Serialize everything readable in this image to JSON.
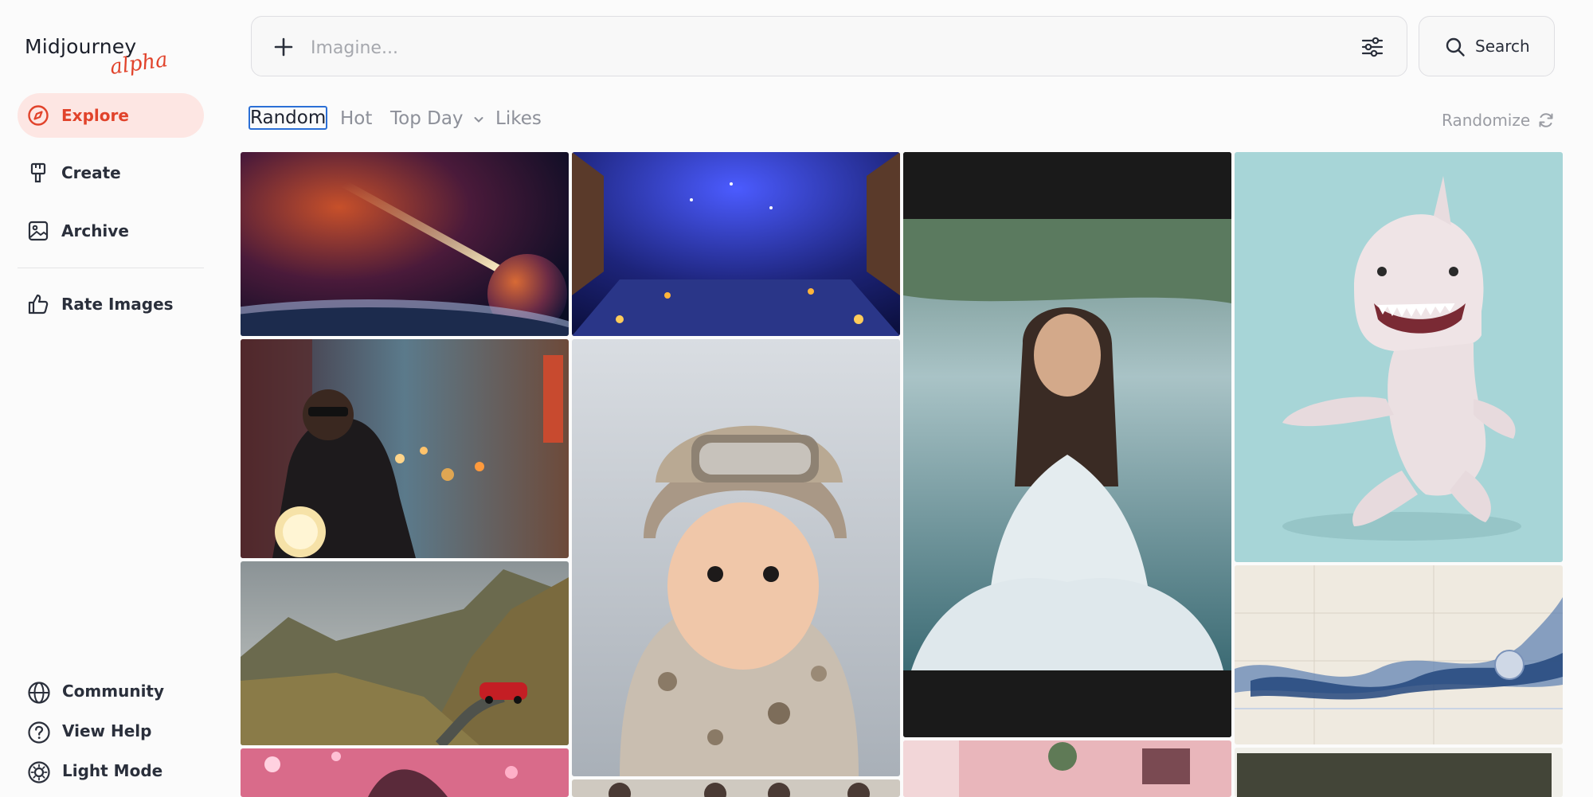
{
  "app": {
    "logo_main": "Midjourney",
    "logo_sub": "alpha",
    "accent_color": "#e1432b",
    "focus_color": "#2b6fd6"
  },
  "sidebar": {
    "items": [
      {
        "label": "Explore",
        "icon": "compass-icon",
        "active": true
      },
      {
        "label": "Create",
        "icon": "paintbrush-icon",
        "active": false
      },
      {
        "label": "Archive",
        "icon": "image-icon",
        "active": false
      },
      {
        "label": "Rate Images",
        "icon": "thumbs-up-icon",
        "active": false
      }
    ],
    "footer": [
      {
        "label": "Community",
        "icon": "globe-icon"
      },
      {
        "label": "View Help",
        "icon": "help-circle-icon"
      },
      {
        "label": "Light Mode",
        "icon": "sun-icon"
      }
    ]
  },
  "topbar": {
    "imagine_placeholder": "Imagine...",
    "search_label": "Search",
    "plus_icon": "plus-icon",
    "filter_icon": "sliders-icon",
    "search_icon": "search-icon"
  },
  "tabs": [
    {
      "label": "Random",
      "selected": true
    },
    {
      "label": "Hot",
      "selected": false
    },
    {
      "label": "Top Day",
      "selected": false,
      "dropdown": true
    },
    {
      "label": "Likes",
      "selected": false
    }
  ],
  "randomize_label": "Randomize",
  "gallery": [
    {
      "subject": "comet-over-planet-space-scene"
    },
    {
      "subject": "starry-night-tent-interior"
    },
    {
      "subject": "man-in-white-robe-by-water"
    },
    {
      "subject": "pink-shark-creature-sitting"
    },
    {
      "subject": "biker-in-neon-city"
    },
    {
      "subject": "baby-in-soldier-helmet-snow"
    },
    {
      "subject": "blue-ink-smoke-abstract"
    },
    {
      "subject": "red-car-mountain-valley"
    },
    {
      "subject": "pink-sparkle-hair"
    },
    {
      "subject": "sketch-figures"
    },
    {
      "subject": "pink-room-interior"
    },
    {
      "subject": "dark-olive-frame"
    }
  ]
}
